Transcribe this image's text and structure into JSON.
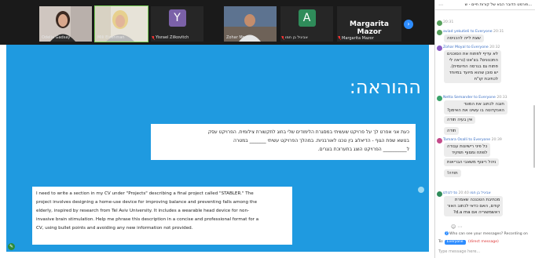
{
  "participants": [
    {
      "name": "Odelia Gadsay",
      "style": "photo-woman-1"
    },
    {
      "name": "Mili Eizenman",
      "style": "photo-woman-2",
      "active": true
    },
    {
      "name": "Yisrael Zilkovitch",
      "letter": "Y",
      "color": "#7b61a8",
      "mic_off": true
    },
    {
      "name": "Zohar Moyal",
      "style": "photo-man"
    },
    {
      "name": "אביגיל בן חמו",
      "letter": "A",
      "color": "#2f8c5a",
      "mic_off": true
    },
    {
      "name": "Margarita Mazor",
      "big_name": "Margarita Mazor",
      "mic_off": true
    }
  ],
  "strip_next_icon": "chevron-right-icon",
  "slide": {
    "title": "ההוראה:",
    "instruction_lines": [
      "כעת אני אפרט לך על פרויקט שעשיתי במסגרת הלימודים שלי בחוג לתקשורת צילומית. הפרויקט עסק",
      "בנושא שפת הגוף - הדיאלוג בין טכנו לאורבניות. במהלך הפרויקט עשיתי _______ במטרה",
      "ל__________ הפרויקט הוצג בתערוכת בוגרים."
    ],
    "prompt_lines": [
      "I need to write a section in my CV under \"Projects\" describing a final project called \"STABLER.\" The",
      "project involves designing a home-use device for improving balance and preventing falls among the",
      "elderly, inspired by research from Tel Aviv University. It includes a wearable head device for non-",
      "invasive brain stimulation. Help me phrase this description in a concise and professional format for a",
      "CV, using bullet points and avoiding any new information not provided."
    ]
  },
  "chat": {
    "title": "...פורמט הדובר הבא של קורות חיים - ש",
    "messages": [
      {
        "sender": "",
        "time": "20:31",
        "lines": [
          "שגיאה פה"
        ],
        "avatar_color": "#57a05c"
      },
      {
        "sender": "",
        "time": "",
        "lines": [
          "שצת לייה להכניסה"
        ],
        "avatar_color": ""
      },
      {
        "sender": "aviad yekutieli to Everyone",
        "time": "20:31",
        "lines": [
          "שצת לייה להכניסה"
        ],
        "avatar_color": "#57a05c"
      },
      {
        "sender": "Zohar Moyal to Everyone",
        "time": "20:32",
        "lines": [
          "לא עדיף לפתוח את הסוכנים",
          "התכנונים? בצ'אט (נראה לי",
          "פתוח גם בגרסה החינמית).",
          "יש סוכן שהוא מיועד במיוחד",
          "לכתיבת קו\"ח"
        ],
        "avatar_color": "#8a5ac4"
      },
      {
        "sender": "Netta Semander to Everyone",
        "time": "20:33",
        "lines": [
          "חובה לכתוב את המונד",
          "האנקדוטה בו עשינו את האימון?"
        ],
        "avatar_color": "#3aa36a"
      },
      {
        "sender": "",
        "time": "",
        "lines": [
          "אין בעיה תודה"
        ],
        "avatar_color": ""
      },
      {
        "sender": "",
        "time": "",
        "lines": [
          "תודה"
        ],
        "avatar_color": ""
      },
      {
        "sender": "Tamara Osalli to Everyone",
        "time": "20:39",
        "lines": [
          "כל פיני רישיונות עבודה",
          "לפתח ומסוף תפקיד"
        ],
        "avatar_color": "#c44a8a"
      },
      {
        "sender": "",
        "time": "",
        "lines": [
          "ניהל ריצוף משאבי הבריאות"
        ],
        "avatar_color": ""
      },
      {
        "sender": "",
        "time": "",
        "lines": [
          "תודה!"
        ],
        "avatar_color": ""
      },
      {
        "sender": "לכולם to אביגיל בן חמו",
        "time": "20:40",
        "lines": [
          "מכתיבת הטכנכה שאמרת",
          "קודם, האם כדאי לכתוב האור",
          "ראשמשוריה אם d.a ma?"
        ],
        "avatar_color": "#2f8c5a"
      }
    ],
    "who_can_see": "Who can see your messages? Recording on",
    "to_label": "To:",
    "to_value": "Everyone",
    "direct_label": "(direct message)",
    "input_placeholder": "Type message here..."
  }
}
